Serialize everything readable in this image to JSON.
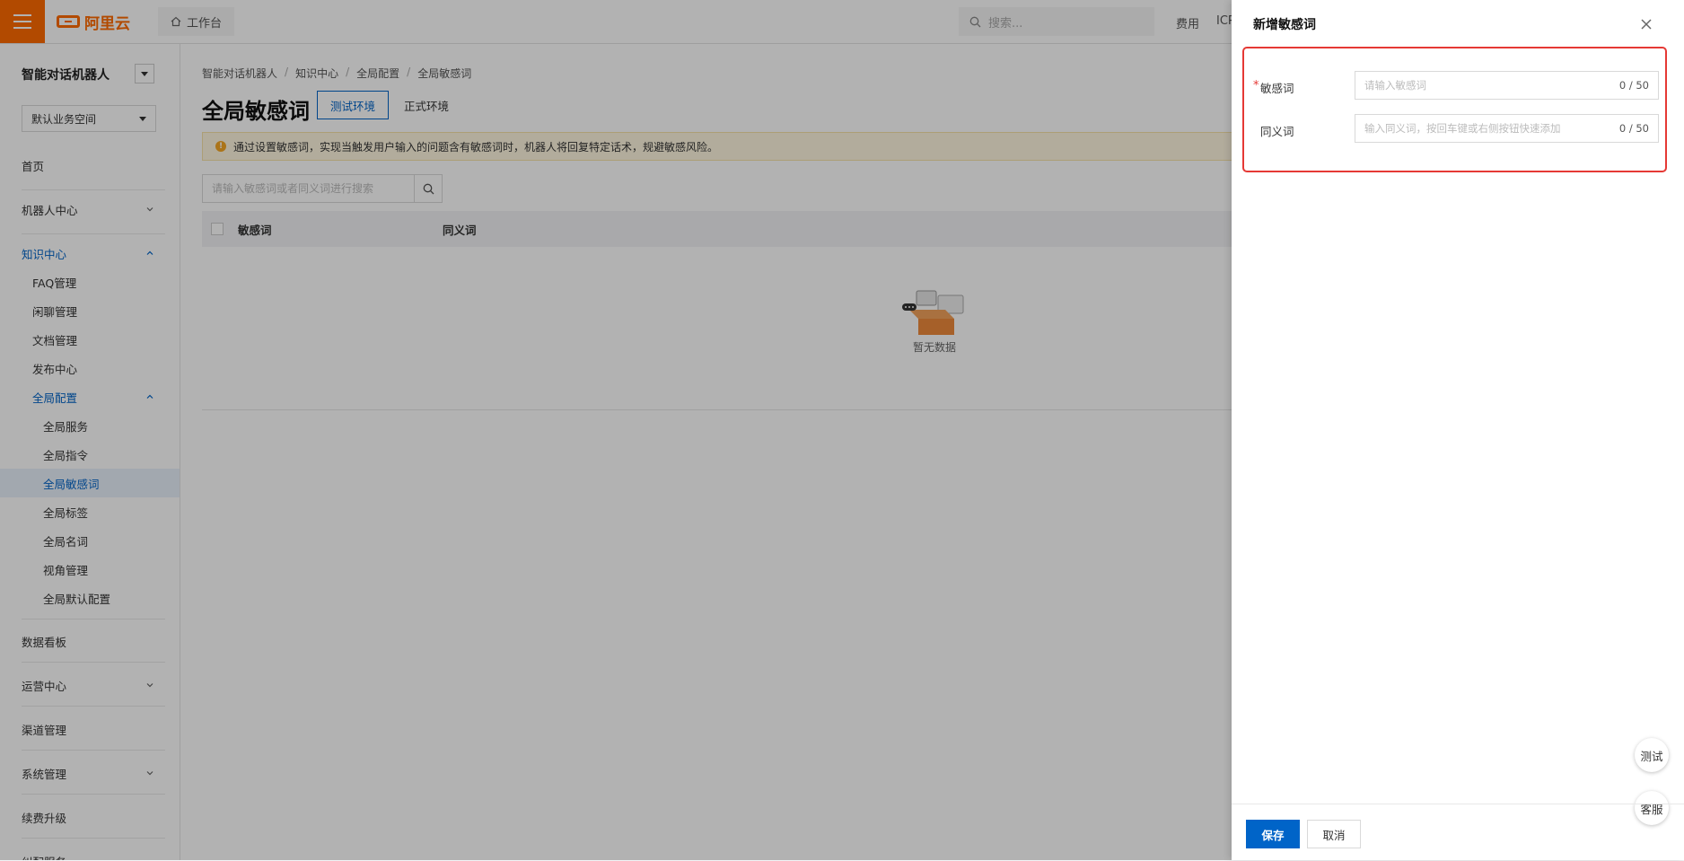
{
  "topbar": {
    "brand": "阿里云",
    "workbench": "工作台",
    "search_placeholder": "搜索...",
    "links": [
      "费用",
      "ICP"
    ]
  },
  "sidebar": {
    "title": "智能对话机器人",
    "workspace": "默认业务空间",
    "items": [
      {
        "label": "首页"
      },
      {
        "label": "机器人中心"
      },
      {
        "label": "知识中心"
      },
      {
        "label": "FAQ管理"
      },
      {
        "label": "闲聊管理"
      },
      {
        "label": "文档管理"
      },
      {
        "label": "发布中心"
      },
      {
        "label": "全局配置"
      },
      {
        "label": "全局服务"
      },
      {
        "label": "全局指令"
      },
      {
        "label": "全局敏感词"
      },
      {
        "label": "全局标签"
      },
      {
        "label": "全局名词"
      },
      {
        "label": "视角管理"
      },
      {
        "label": "全局默认配置"
      },
      {
        "label": "数据看板"
      },
      {
        "label": "运营中心"
      },
      {
        "label": "渠道管理"
      },
      {
        "label": "系统管理"
      },
      {
        "label": "续费升级"
      },
      {
        "label": "纠配服务"
      }
    ]
  },
  "main": {
    "breadcrumbs": [
      "智能对话机器人",
      "知识中心",
      "全局配置",
      "全局敏感词"
    ],
    "title": "全局敏感词",
    "env_tabs": [
      "测试环境",
      "正式环境"
    ],
    "notice": "通过设置敏感词，实现当触发用户输入的问题含有敏感词时，机器人将回复特定话术，规避敏感风险。",
    "search_placeholder": "请输入敏感词或者同义词进行搜索",
    "columns": [
      "敏感词",
      "同义词"
    ],
    "empty_text": "暂无数据"
  },
  "drawer": {
    "title": "新增敏感词",
    "fields": [
      {
        "label": "敏感词",
        "required": true,
        "placeholder": "请输入敏感词",
        "count": "0 / 50"
      },
      {
        "label": "同义词",
        "required": false,
        "placeholder": "输入同义词，按回车键或右侧按钮快速添加",
        "count": "0 / 50"
      }
    ],
    "float_buttons": [
      "测试",
      "客服"
    ],
    "save": "保存",
    "cancel": "取消"
  },
  "colors": {
    "accent": "#ff6a00",
    "primary": "#0064c8",
    "highlight": "#e53935",
    "notice_bg": "#fff7e0"
  }
}
